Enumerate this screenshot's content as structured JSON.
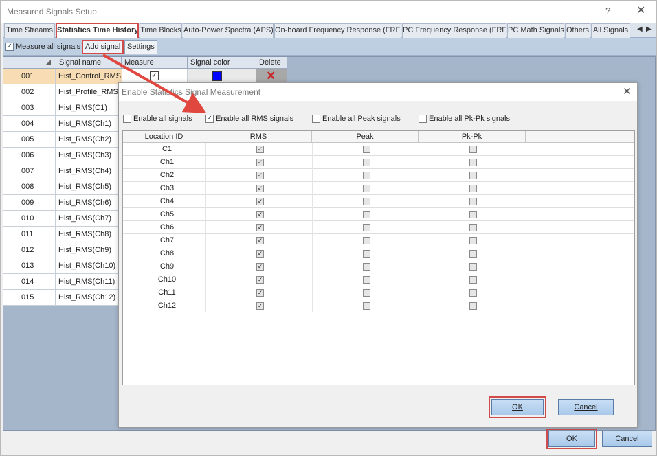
{
  "window": {
    "title": "Measured Signals Setup",
    "help": "?",
    "close": "✕"
  },
  "tabs": [
    {
      "label": "Time Streams"
    },
    {
      "label": "Statistics Time History"
    },
    {
      "label": "Time Blocks"
    },
    {
      "label": "Auto-Power Spectra (APS)"
    },
    {
      "label": "On-board Frequency Response (FRF)"
    },
    {
      "label": "PC Frequency Response (FRF)"
    },
    {
      "label": "PC Math Signals"
    },
    {
      "label": "Others"
    },
    {
      "label": "All Signals"
    }
  ],
  "tab_nav": {
    "prev": "◀",
    "next": "▶"
  },
  "toolbar": {
    "measure_all_label": "Measure all signals",
    "measure_all_checked": "✓",
    "add_signal": "Add signal",
    "settings": "Settings"
  },
  "grid": {
    "headers": {
      "name": "Signal name",
      "measure": "Measure",
      "color": "Signal color",
      "delete": "Delete"
    },
    "first_row_measure": "✓",
    "first_row_delete": "✕",
    "signal_color": "#0000ff",
    "rows": [
      {
        "id": "001",
        "name": "Hist_Control_RMS"
      },
      {
        "id": "002",
        "name": "Hist_Profile_RMS"
      },
      {
        "id": "003",
        "name": "Hist_RMS(C1)"
      },
      {
        "id": "004",
        "name": "Hist_RMS(Ch1)"
      },
      {
        "id": "005",
        "name": "Hist_RMS(Ch2)"
      },
      {
        "id": "006",
        "name": "Hist_RMS(Ch3)"
      },
      {
        "id": "007",
        "name": "Hist_RMS(Ch4)"
      },
      {
        "id": "008",
        "name": "Hist_RMS(Ch5)"
      },
      {
        "id": "009",
        "name": "Hist_RMS(Ch6)"
      },
      {
        "id": "010",
        "name": "Hist_RMS(Ch7)"
      },
      {
        "id": "011",
        "name": "Hist_RMS(Ch8)"
      },
      {
        "id": "012",
        "name": "Hist_RMS(Ch9)"
      },
      {
        "id": "013",
        "name": "Hist_RMS(Ch10)"
      },
      {
        "id": "014",
        "name": "Hist_RMS(Ch11)"
      },
      {
        "id": "015",
        "name": "Hist_RMS(Ch12)"
      }
    ]
  },
  "main_buttons": {
    "ok": "OK",
    "cancel": "Cancel"
  },
  "dialog": {
    "title": "Enable Statistics Signal Measurement",
    "close": "✕",
    "checks": [
      {
        "label": "Enable all signals",
        "checked": ""
      },
      {
        "label": "Enable all RMS signals",
        "checked": "✓"
      },
      {
        "label": "Enable all Peak signals",
        "checked": ""
      },
      {
        "label": "Enable all Pk-Pk signals",
        "checked": ""
      }
    ],
    "headers": {
      "loc": "Location ID",
      "rms": "RMS",
      "peak": "Peak",
      "pkpk": "Pk-Pk"
    },
    "check_mark": "✓",
    "rows": [
      {
        "loc": "C1"
      },
      {
        "loc": "Ch1"
      },
      {
        "loc": "Ch2"
      },
      {
        "loc": "Ch3"
      },
      {
        "loc": "Ch4"
      },
      {
        "loc": "Ch5"
      },
      {
        "loc": "Ch6"
      },
      {
        "loc": "Ch7"
      },
      {
        "loc": "Ch8"
      },
      {
        "loc": "Ch9"
      },
      {
        "loc": "Ch10"
      },
      {
        "loc": "Ch11"
      },
      {
        "loc": "Ch12"
      }
    ],
    "ok": "OK",
    "cancel": "Cancel"
  },
  "colors": {
    "highlight": "#d24b4b",
    "accent": "#a9c9ea",
    "selected_row": "#f8ddb4"
  }
}
